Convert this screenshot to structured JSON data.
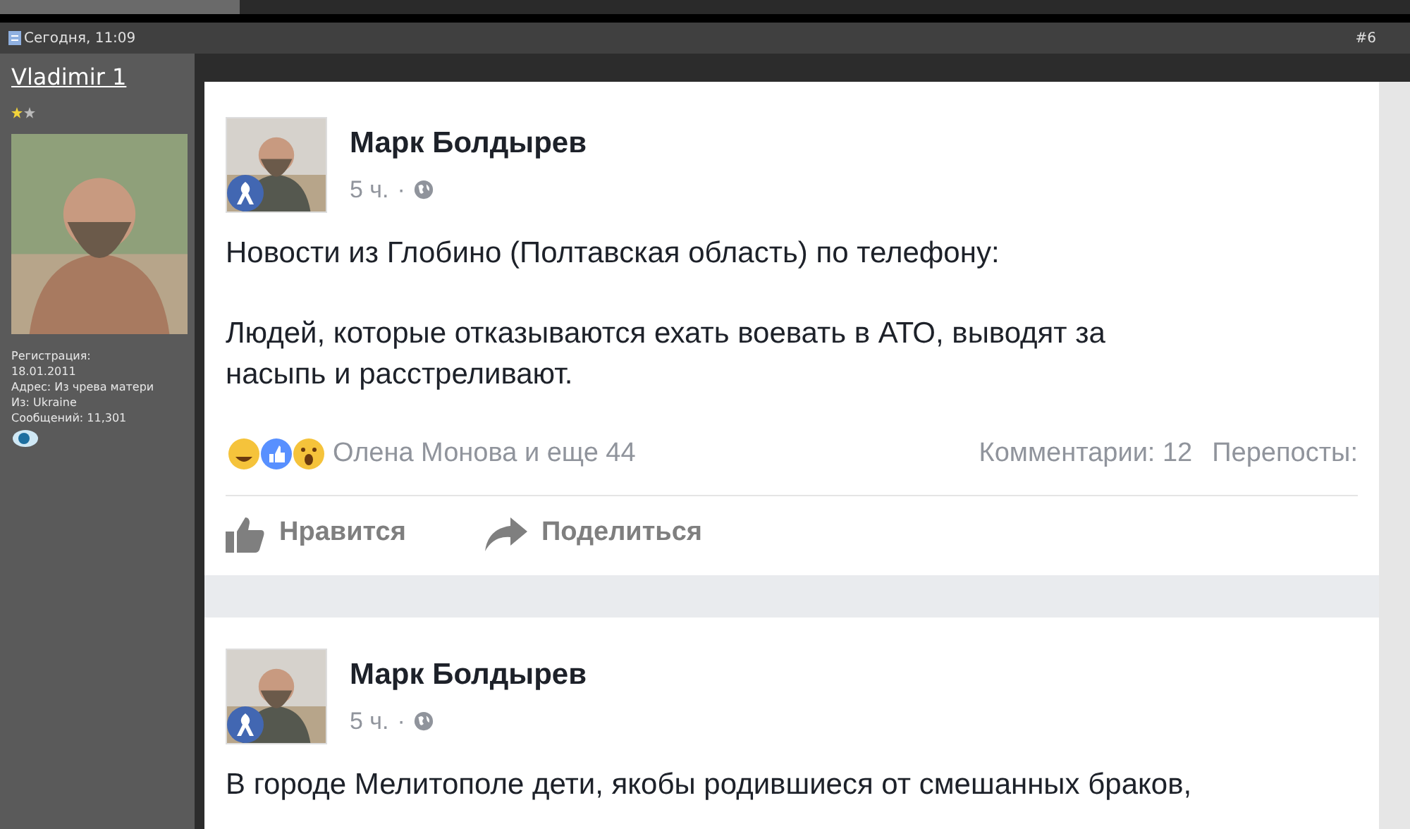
{
  "post_header": {
    "date": "Сегодня, 11:09",
    "post_number": "#6"
  },
  "user": {
    "name": "Vladimir 1",
    "rank_stars": [
      {
        "color": "#f2d33a"
      },
      {
        "color": "#bbbbbb"
      }
    ],
    "details": [
      "Регистрация:",
      "18.01.2011",
      "Адрес: Из чрева матери",
      "Из: Ukraine",
      "Сообщений: 11,301"
    ]
  },
  "embedded_posts": [
    {
      "author": "Марк Болдырев",
      "time": "5 ч.",
      "separator": "·",
      "paragraphs": [
        "Новости из Глобино (Полтавская область) по телефону:",
        "Людей, которые отказываются ехать воевать в АТО, выводят за насыпь и расстреливают."
      ],
      "reactions_text": "Олена Монова и еще 44",
      "comments": "Комментарии: 12",
      "shares": "Перепосты:",
      "actions": [
        {
          "kind": "like",
          "label": "Нравится"
        },
        {
          "kind": "share",
          "label": "Поделиться"
        }
      ]
    },
    {
      "author": "Марк Болдырев",
      "time": "5 ч.",
      "separator": "·",
      "paragraphs": [
        "В городе Мелитополе дети, якобы родившиеся от смешанных браков,"
      ]
    }
  ]
}
